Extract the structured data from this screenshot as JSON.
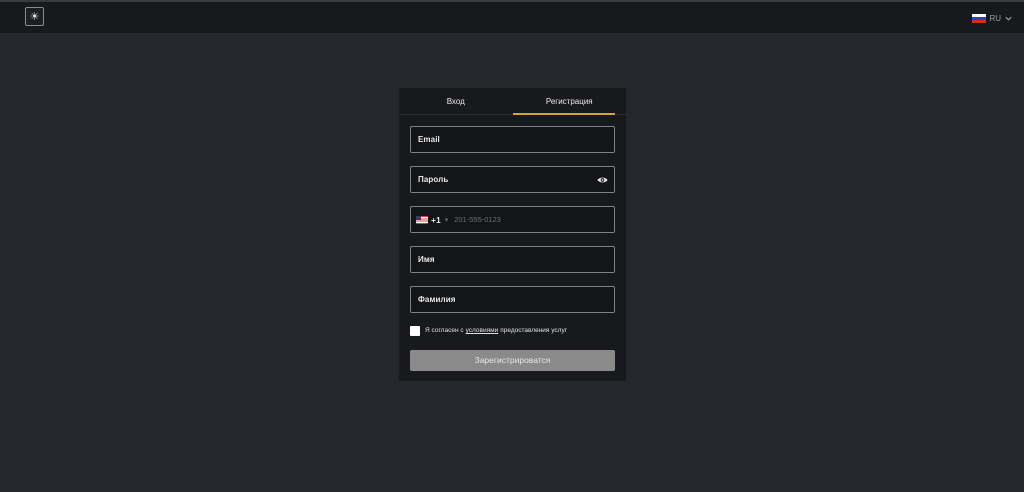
{
  "header": {
    "theme_icon": "sun-icon",
    "language": {
      "code": "RU",
      "flag": "russia-flag-icon",
      "chevron": "chevron-down-icon"
    }
  },
  "auth": {
    "tabs": [
      {
        "label": "Вход",
        "active": false
      },
      {
        "label": "Регистрация",
        "active": true
      }
    ],
    "accent_color": "#d9a531",
    "fields": {
      "email": {
        "label": "Email"
      },
      "password": {
        "label": "Пароль",
        "icon": "eye-icon"
      },
      "phone": {
        "country_flag": "usa-flag-icon",
        "dial_code": "+1",
        "separator": "▾",
        "placeholder": "201-555-0123"
      },
      "first_name": {
        "label": "Имя"
      },
      "last_name": {
        "label": "Фамилия"
      }
    },
    "agreement": {
      "checked": false,
      "before": "Я согласен с",
      "link": "условиями",
      "after": "предоставления услуг"
    },
    "submit_label": "Зарегистрироватся"
  }
}
